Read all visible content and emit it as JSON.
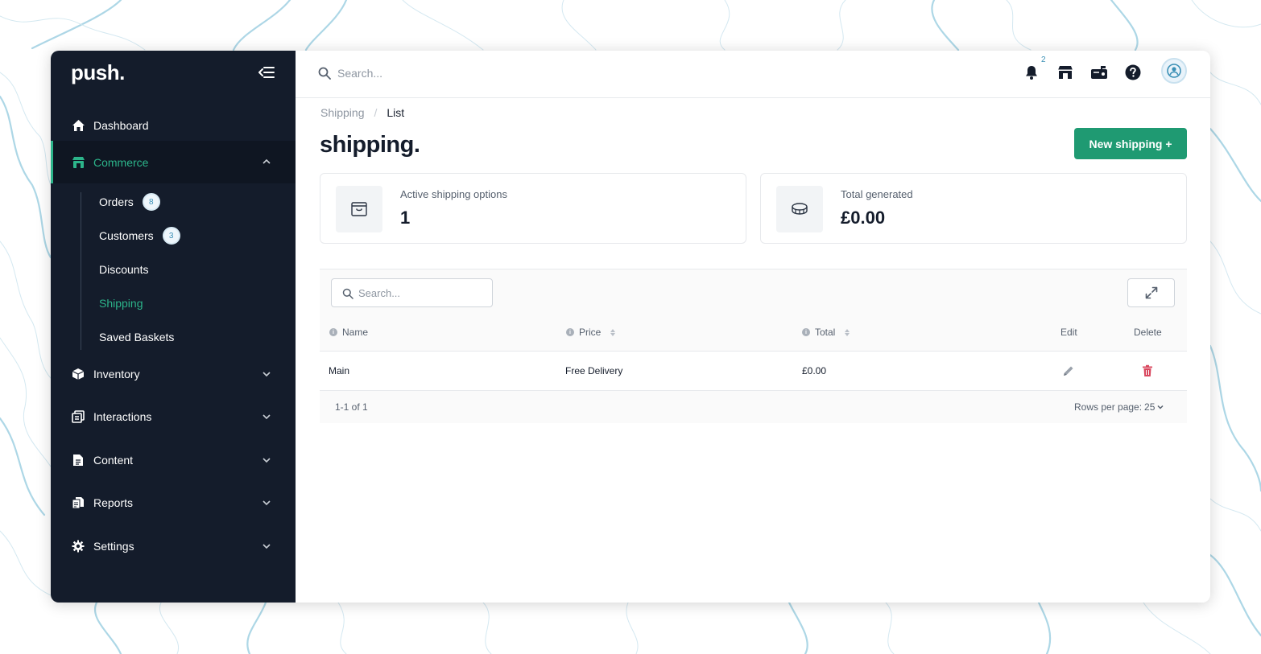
{
  "app": {
    "logo": "push."
  },
  "sidebar": {
    "items": [
      {
        "label": "Dashboard",
        "icon": "home-icon"
      },
      {
        "label": "Commerce",
        "icon": "store-icon"
      },
      {
        "label": "Inventory",
        "icon": "box-icon"
      },
      {
        "label": "Interactions",
        "icon": "copy-icon"
      },
      {
        "label": "Content",
        "icon": "document-icon"
      },
      {
        "label": "Reports",
        "icon": "reports-icon"
      },
      {
        "label": "Settings",
        "icon": "gear-icon"
      }
    ],
    "commerce_sub": [
      {
        "label": "Orders",
        "badge": "8"
      },
      {
        "label": "Customers",
        "badge": "3"
      },
      {
        "label": "Discounts"
      },
      {
        "label": "Shipping"
      },
      {
        "label": "Saved Baskets"
      }
    ]
  },
  "topbar": {
    "search_placeholder": "Search...",
    "notification_count": "2"
  },
  "breadcrumb": {
    "root": "Shipping",
    "separator": "/",
    "current": "List"
  },
  "page": {
    "title": "shipping.",
    "new_button": "New shipping +"
  },
  "stats": [
    {
      "label": "Active shipping options",
      "value": "1",
      "icon": "package-icon"
    },
    {
      "label": "Total generated",
      "value": "£0.00",
      "icon": "coins-icon"
    }
  ],
  "table": {
    "search_placeholder": "Search...",
    "columns": {
      "name": "Name",
      "price": "Price",
      "total": "Total",
      "edit": "Edit",
      "delete": "Delete"
    },
    "rows": [
      {
        "name": "Main",
        "price": "Free Delivery",
        "total": "£0.00"
      }
    ],
    "range": "1-1 of 1",
    "rows_per_page_label": "Rows per page:",
    "rows_per_page_value": "25"
  },
  "colors": {
    "sidebar_bg": "#141c2b",
    "accent": "#2cb48a",
    "primary_button": "#1f9a72",
    "delete": "#d9485f",
    "badge_text": "#3a8fb5"
  }
}
